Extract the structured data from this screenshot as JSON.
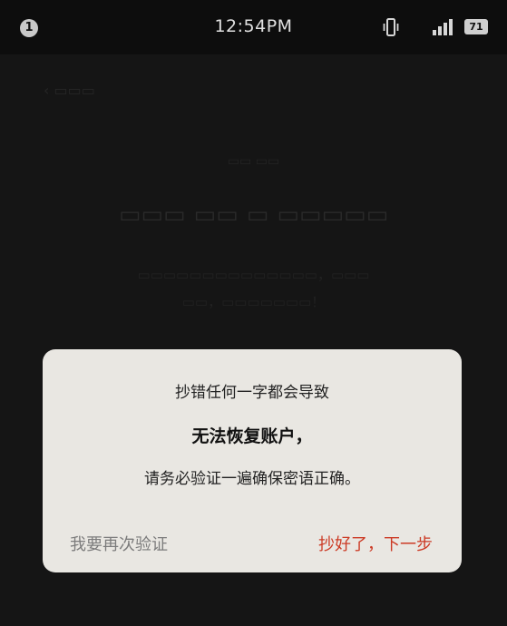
{
  "status_bar": {
    "notification_count": "1",
    "time": "12:54PM",
    "battery": "71",
    "icons": [
      "vibrate-icon",
      "signal-icon",
      "battery-icon"
    ]
  },
  "dialog": {
    "line1": "抄错任何一字都会导致",
    "line2": "无法恢复账户，",
    "line3": "请务必验证一遍确保密语正确。",
    "retry_label": "我要再次验证",
    "next_label": "抄好了，下一步"
  },
  "colors": {
    "accent": "#cc3a24",
    "dialog_bg": "#e9e7e2",
    "secondary_button": "#7c7c7c"
  }
}
